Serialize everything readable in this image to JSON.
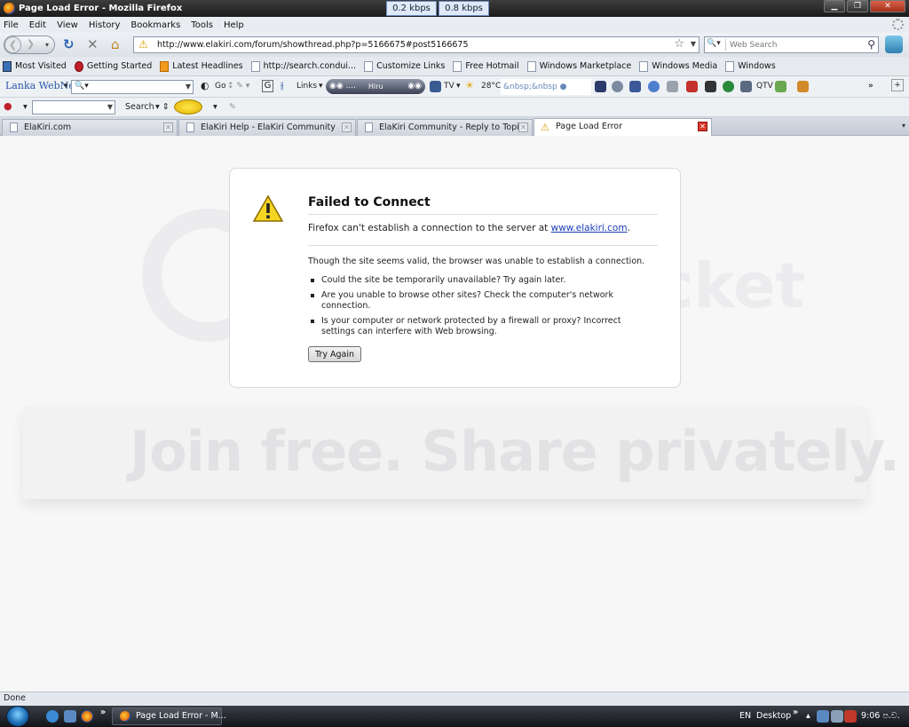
{
  "window": {
    "title": "Page Load Error - Mozilla Firefox",
    "speed_down": "0.2 kbps",
    "speed_up": "0.8 kbps"
  },
  "menu": [
    "File",
    "Edit",
    "View",
    "History",
    "Bookmarks",
    "Tools",
    "Help"
  ],
  "nav": {
    "url": "http://www.elakiri.com/forum/showthread.php?p=5166675#post5166675",
    "search_placeholder": "Web Search"
  },
  "bookmarks": [
    {
      "label": "Most Visited",
      "icon": "most-visited-icon"
    },
    {
      "label": "Getting Started",
      "icon": "getting-started-icon"
    },
    {
      "label": "Latest Headlines",
      "icon": "rss-icon"
    },
    {
      "label": "http://search.condui...",
      "icon": "page-icon"
    },
    {
      "label": "Customize Links",
      "icon": "page-icon"
    },
    {
      "label": "Free Hotmail",
      "icon": "page-icon"
    },
    {
      "label": "Windows Marketplace",
      "icon": "page-icon"
    },
    {
      "label": "Windows Media",
      "icon": "page-icon"
    },
    {
      "label": "Windows",
      "icon": "page-icon"
    }
  ],
  "toolbar2": {
    "brand": "Lanka WebNet",
    "go": "Go",
    "links": "Links",
    "station": "Hiru",
    "tv": "TV",
    "temp": "28°C",
    "ticker": "&nbsp;&nbsp",
    "qtv": "QTV"
  },
  "toolbar3": {
    "search": "Search"
  },
  "tabs": [
    {
      "label": "ElaKiri.com"
    },
    {
      "label": "ElaKiri Help - ElaKiri Community"
    },
    {
      "label": "ElaKiri Community - Reply to Topic"
    },
    {
      "label": "Page Load Error"
    }
  ],
  "error": {
    "title": "Failed to Connect",
    "msg_prefix": "Firefox can't establish a connection to the server at ",
    "msg_link": "www.elakiri.com",
    "msg_suffix": ".",
    "long_desc": "Though the site seems valid, the browser was unable to establish a connection.",
    "bullets": [
      "Could the site be temporarily unavailable? Try again later.",
      "Are you unable to browse other sites? Check the computer's network connection.",
      "Is your computer or network protected by a firewall or proxy? Incorrect settings can interfere with Web browsing."
    ],
    "button": "Try Again"
  },
  "watermark": {
    "word": "bucket",
    "banner": "Join free. Share privately."
  },
  "status": "Done",
  "taskbar": {
    "task": "Page Load Error - M...",
    "lang": "EN",
    "desktop": "Desktop",
    "clock": "9:06 ප.ව."
  },
  "colors": {
    "link": "#1d3cb5",
    "warning": "#d9a000",
    "tab_close_active": "#d9352a"
  }
}
